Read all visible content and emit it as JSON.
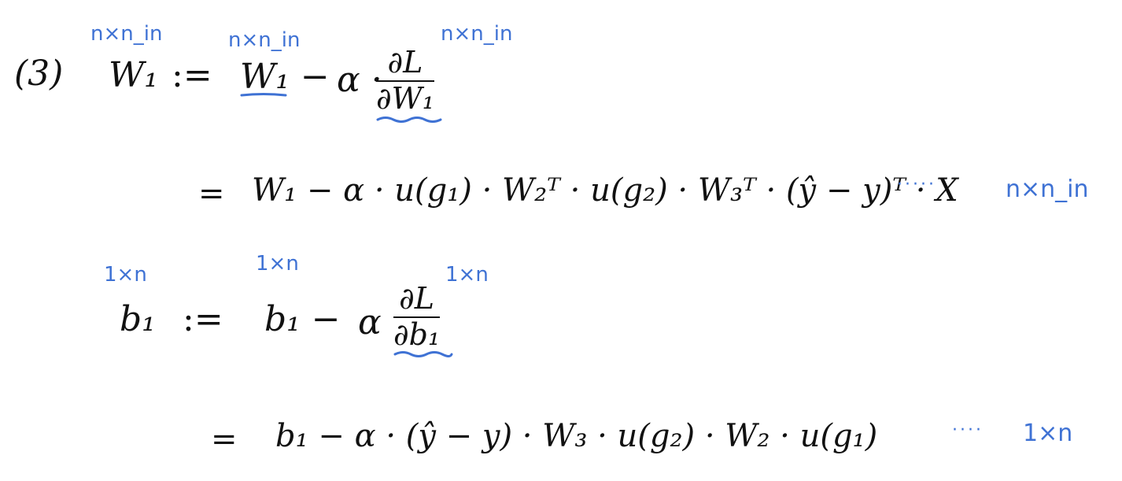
{
  "colors": {
    "ink": "#111111",
    "annotation": "#3f72d4"
  },
  "eq1": {
    "label": "(3)",
    "lhs": "W₁",
    "assign": ":=",
    "rhs_term": "W₁ −",
    "alpha": "α ·",
    "frac_num": "∂L",
    "frac_den": "∂W₁",
    "dim_lhs": "n×n_in",
    "dim_rhs": "n×n_in",
    "dim_grad": "n×n_in"
  },
  "eq2": {
    "equals": "=",
    "expr": "W₁ − α · u(g₁) · W₂ᵀ · u(g₂) · W₃ᵀ · (ŷ − y)ᵀ · X",
    "dots": "·····",
    "dim": "n×n_in"
  },
  "eq3": {
    "lhs": "b₁",
    "assign": ":=",
    "rhs_term": "b₁ −",
    "alpha": "α",
    "frac_num": "∂L",
    "frac_den": "∂b₁",
    "dim_lhs": "1×n",
    "dim_rhs": "1×n",
    "dim_grad": "1×n"
  },
  "eq4": {
    "equals": "=",
    "expr": "b₁ − α · (ŷ − y) · W₃ · u(g₂) · W₂ · u(g₁)",
    "dots": "····",
    "dim": "1×n"
  }
}
